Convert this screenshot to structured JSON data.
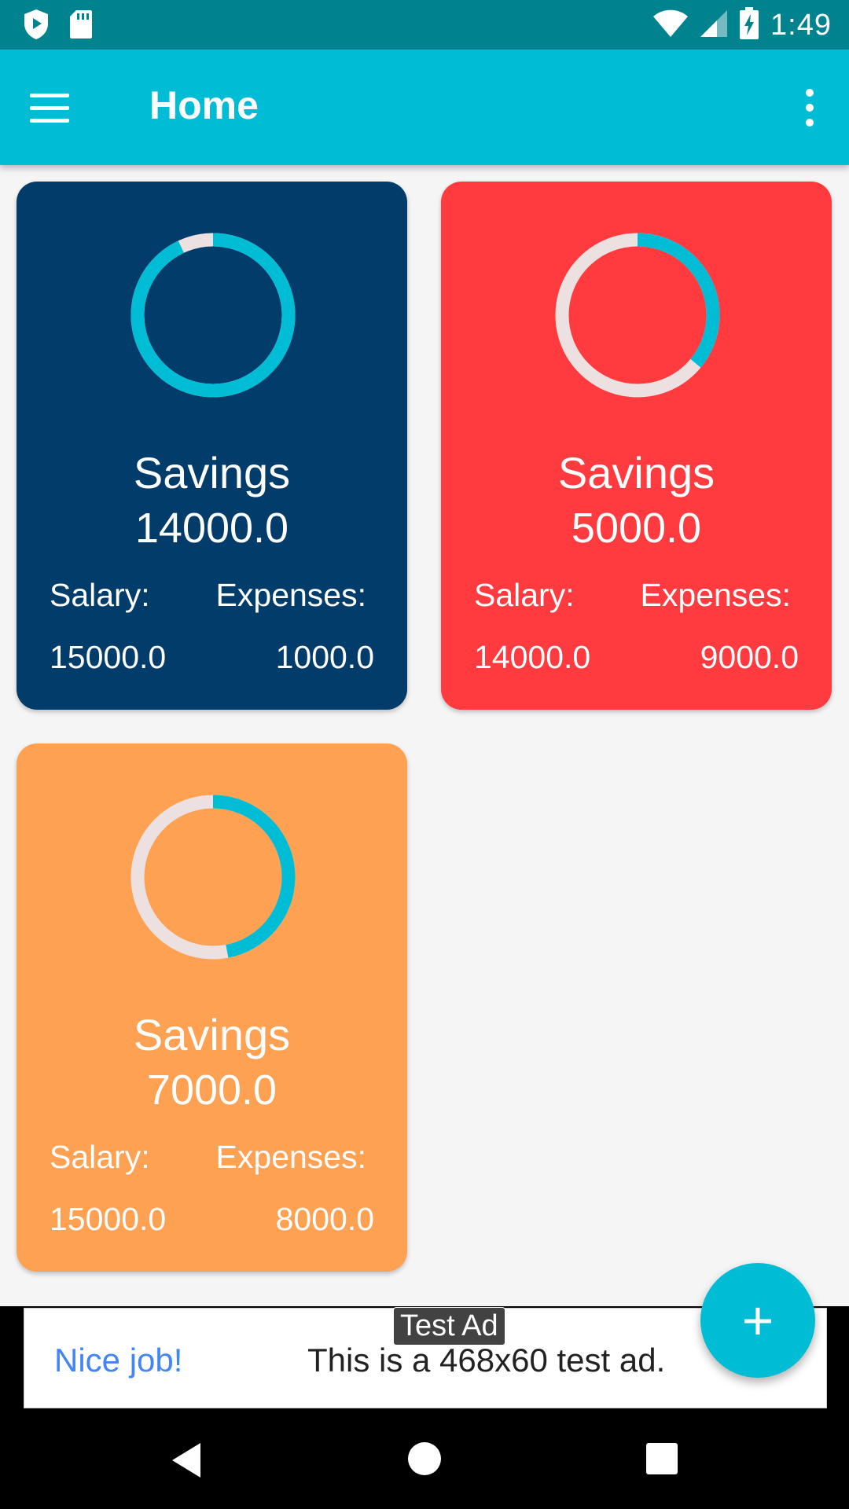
{
  "status_bar": {
    "time": "1:49",
    "icons": [
      "play-protect-icon",
      "sd-card-icon",
      "wifi-icon",
      "signal-icon",
      "battery-charging-icon"
    ]
  },
  "app_bar": {
    "title": "Home",
    "menu_icon": "hamburger-menu-icon",
    "overflow_icon": "more-vert-icon"
  },
  "colors": {
    "app_bar": "#00bcd4",
    "status_bar": "#00838f",
    "ring_progress": "#00bcd4",
    "ring_track": "#ece0e0"
  },
  "cards": [
    {
      "title": "Savings",
      "savings": "14000.0",
      "salary_label": "Salary:",
      "salary": "15000.0",
      "expenses_label": "Expenses:",
      "expenses": "1000.0",
      "progress_fraction": 0.93,
      "color": "#023c6a"
    },
    {
      "title": "Savings",
      "savings": "5000.0",
      "salary_label": "Salary:",
      "salary": "14000.0",
      "expenses_label": "Expenses:",
      "expenses": "9000.0",
      "progress_fraction": 0.36,
      "color": "#ff3b3f"
    },
    {
      "title": "Savings",
      "savings": "7000.0",
      "salary_label": "Salary:",
      "salary": "15000.0",
      "expenses_label": "Expenses:",
      "expenses": "8000.0",
      "progress_fraction": 0.47,
      "color": "#ffa152"
    }
  ],
  "fab": {
    "icon": "plus-icon",
    "label": "+"
  },
  "ad": {
    "tag": "Test Ad",
    "headline": "Nice job!",
    "body": "This is a 468x60 test ad."
  },
  "nav_bar": {
    "icons": [
      "back-icon",
      "home-icon",
      "recents-icon"
    ]
  }
}
